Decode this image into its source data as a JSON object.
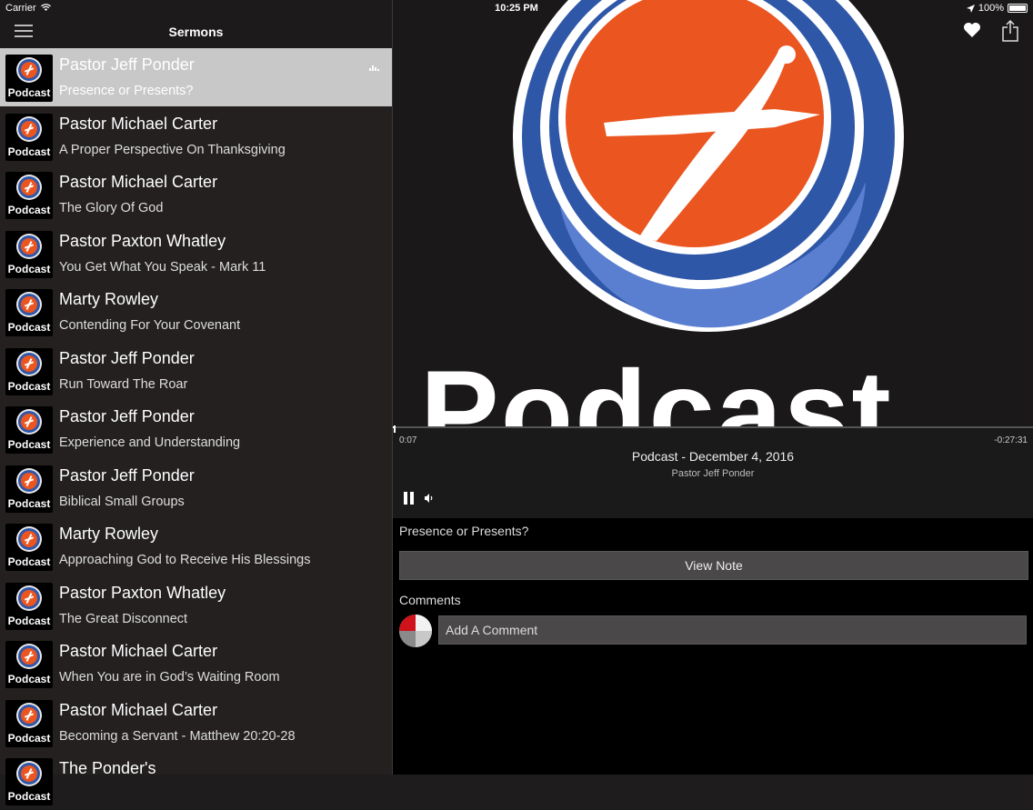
{
  "status_bar": {
    "carrier": "Carrier",
    "time": "10:25 PM",
    "battery": "100%"
  },
  "sidebar": {
    "title": "Sermons",
    "items": [
      {
        "name": "Pastor Jeff Ponder",
        "title": "Presence or Presents?",
        "thumb_label": "Podcast",
        "selected": true
      },
      {
        "name": "Pastor Michael Carter",
        "title": "A Proper Perspective On Thanksgiving",
        "thumb_label": "Podcast"
      },
      {
        "name": "Pastor Michael Carter",
        "title": "The Glory Of God",
        "thumb_label": "Podcast"
      },
      {
        "name": "Pastor Paxton Whatley",
        "title": "You Get What You Speak - Mark 11",
        "thumb_label": "Podcast"
      },
      {
        "name": "Marty Rowley",
        "title": "Contending For Your Covenant",
        "thumb_label": "Podcast"
      },
      {
        "name": "Pastor Jeff Ponder",
        "title": "Run Toward The Roar",
        "thumb_label": "Podcast"
      },
      {
        "name": "Pastor Jeff Ponder",
        "title": "Experience and Understanding",
        "thumb_label": "Podcast"
      },
      {
        "name": "Pastor Jeff Ponder",
        "title": "Biblical Small Groups",
        "thumb_label": "Podcast"
      },
      {
        "name": "Marty Rowley",
        "title": "Approaching God to Receive His Blessings",
        "thumb_label": "Podcast"
      },
      {
        "name": "Pastor Paxton Whatley",
        "title": "The Great Disconnect",
        "thumb_label": "Podcast"
      },
      {
        "name": "Pastor Michael Carter",
        "title": "When You are in God’s Waiting Room",
        "thumb_label": "Podcast"
      },
      {
        "name": "Pastor Michael Carter",
        "title": "Becoming a Servant - Matthew 20:20-28",
        "thumb_label": "Podcast"
      },
      {
        "name": "The Ponder's",
        "title": "",
        "thumb_label": "Podcast"
      }
    ]
  },
  "artwork": {
    "text": "Podcast"
  },
  "player": {
    "elapsed": "0:07",
    "remaining": "-0:27:31",
    "progress": 0.004,
    "track_title": "Podcast - December 4, 2016",
    "track_artist": "Pastor Jeff Ponder"
  },
  "details": {
    "note_title": "Presence or Presents?",
    "view_note_label": "View Note",
    "comments_label": "Comments",
    "comment_placeholder": "Add A Comment"
  },
  "colors": {
    "accent_orange": "#ea5520",
    "ring_blue": "#2f57a8",
    "selected_row": "#c9c8c8"
  },
  "icons": [
    "menu-icon",
    "heart-icon",
    "share-icon",
    "pause-icon",
    "volume-icon",
    "equalizer-icon",
    "location-icon",
    "wifi-icon",
    "battery-icon"
  ]
}
